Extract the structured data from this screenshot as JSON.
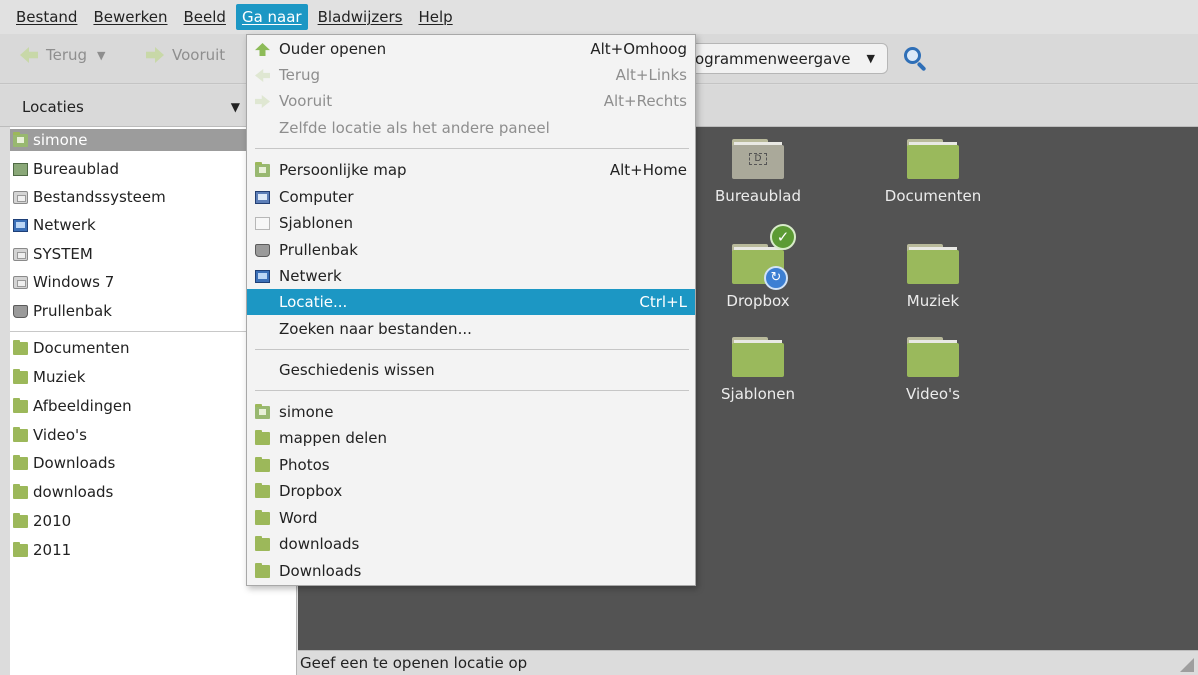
{
  "menubar": {
    "items": [
      "Bestand",
      "Bewerken",
      "Beeld",
      "Ga naar",
      "Bladwijzers",
      "Help"
    ]
  },
  "toolbar": {
    "back_label": "Terug",
    "forward_label": "Vooruit",
    "view_mode": "ogrammenweergave"
  },
  "locbar": {
    "places_label": "Locaties"
  },
  "sidebar": {
    "items": [
      {
        "label": "simone",
        "icon": "home-folder-icon"
      },
      {
        "label": "Bureaublad",
        "icon": "desktop-icon"
      },
      {
        "label": "Bestandssysteem",
        "icon": "drive-icon"
      },
      {
        "label": "Netwerk",
        "icon": "network-icon"
      },
      {
        "label": "SYSTEM",
        "icon": "drive-icon"
      },
      {
        "label": "Windows 7",
        "icon": "drive-icon"
      },
      {
        "label": "Prullenbak",
        "icon": "trash-icon"
      },
      {
        "label": "Documenten",
        "icon": "folder-icon"
      },
      {
        "label": "Muziek",
        "icon": "folder-icon"
      },
      {
        "label": "Afbeeldingen",
        "icon": "folder-icon"
      },
      {
        "label": "Video's",
        "icon": "folder-icon"
      },
      {
        "label": "Downloads",
        "icon": "folder-icon"
      },
      {
        "label": "downloads",
        "icon": "folder-icon"
      },
      {
        "label": "2010",
        "icon": "folder-icon"
      },
      {
        "label": "2011",
        "icon": "folder-icon"
      }
    ]
  },
  "main": {
    "files": [
      {
        "name": "Bureaublad"
      },
      {
        "name": "Documenten"
      },
      {
        "name": "Dropbox"
      },
      {
        "name": "Muziek"
      },
      {
        "name": "Sjablonen"
      },
      {
        "name": "Video's"
      }
    ]
  },
  "go_menu": {
    "items": [
      {
        "label": "Ouder openen",
        "accel": "Alt+Omhoog"
      },
      {
        "label": "Terug",
        "accel": "Alt+Links"
      },
      {
        "label": "Vooruit",
        "accel": "Alt+Rechts"
      },
      {
        "label": "Zelfde locatie als het andere paneel",
        "accel": ""
      },
      {
        "label": "Persoonlijke map",
        "accel": "Alt+Home"
      },
      {
        "label": "Computer",
        "accel": ""
      },
      {
        "label": "Sjablonen",
        "accel": ""
      },
      {
        "label": "Prullenbak",
        "accel": ""
      },
      {
        "label": "Netwerk",
        "accel": ""
      },
      {
        "label": "Locatie...",
        "accel": "Ctrl+L"
      },
      {
        "label": "Zoeken naar bestanden...",
        "accel": ""
      },
      {
        "label": "Geschiedenis wissen",
        "accel": ""
      },
      {
        "label": "simone",
        "accel": ""
      },
      {
        "label": "mappen delen",
        "accel": ""
      },
      {
        "label": "Photos",
        "accel": ""
      },
      {
        "label": "Dropbox",
        "accel": ""
      },
      {
        "label": "Word",
        "accel": ""
      },
      {
        "label": "downloads",
        "accel": ""
      },
      {
        "label": "Downloads",
        "accel": ""
      }
    ]
  },
  "statusbar": {
    "text": "Geef een te openen locatie op"
  },
  "colors": {
    "accent": "#1c97c4",
    "main_bg": "#535353",
    "folder": "#9ab95c"
  }
}
